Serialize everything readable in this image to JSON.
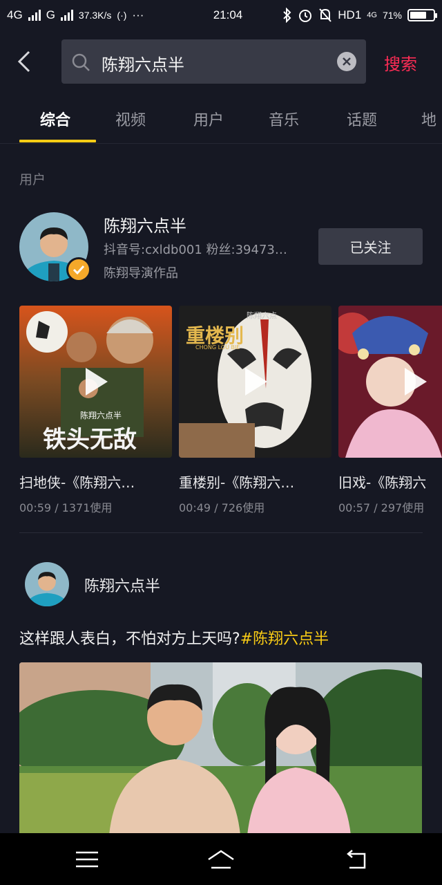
{
  "status_bar": {
    "network1": "4G",
    "network2": "G",
    "speed": "37.3K/s",
    "hotspot": "(·)",
    "more": "···",
    "time": "21:04",
    "hd": "HD1",
    "network_small": "4G",
    "battery_percent": "71%",
    "battery_level": 0.71
  },
  "search": {
    "query": "陈翔六点半",
    "search_button": "搜索"
  },
  "tabs": [
    {
      "label": "综合",
      "active": true
    },
    {
      "label": "视频",
      "active": false
    },
    {
      "label": "用户",
      "active": false
    },
    {
      "label": "音乐",
      "active": false
    },
    {
      "label": "话题",
      "active": false
    },
    {
      "label": "地",
      "active": false
    }
  ],
  "users_section": {
    "label": "用户",
    "user": {
      "name": "陈翔六点半",
      "id_line": "抖音号:cxldb001 粉丝:39473…",
      "description": "陈翔导演作品",
      "follow_label": "已关注",
      "verified": true
    }
  },
  "music": [
    {
      "title": "扫地侠-《陈翔六…",
      "meta": "00:59 / 1371使用"
    },
    {
      "title": "重楼别-《陈翔六…",
      "meta": "00:49 / 726使用"
    },
    {
      "title": "旧戏-《陈翔六",
      "meta": "00:57 / 297使用"
    }
  ],
  "poster_text": {
    "cover1": "铁头无敌",
    "cover1_small": "陈翔六点半",
    "cover2": "重楼别",
    "cover2_sub": "CHONG LOU BIE",
    "cover2_small": "陈翔六点"
  },
  "post": {
    "author": "陈翔六点半",
    "caption": "这样跟人表白，不怕对方上天吗?",
    "hashtag": "#陈翔六点半"
  },
  "colors": {
    "background": "#161823",
    "accent_red": "#fe2c55",
    "accent_yellow": "#facc15",
    "verify_badge": "#f4a82a"
  },
  "icons": [
    "back-icon",
    "search-icon",
    "clear-icon",
    "play-icon",
    "check-icon",
    "menu-icon",
    "home-icon",
    "return-icon"
  ]
}
